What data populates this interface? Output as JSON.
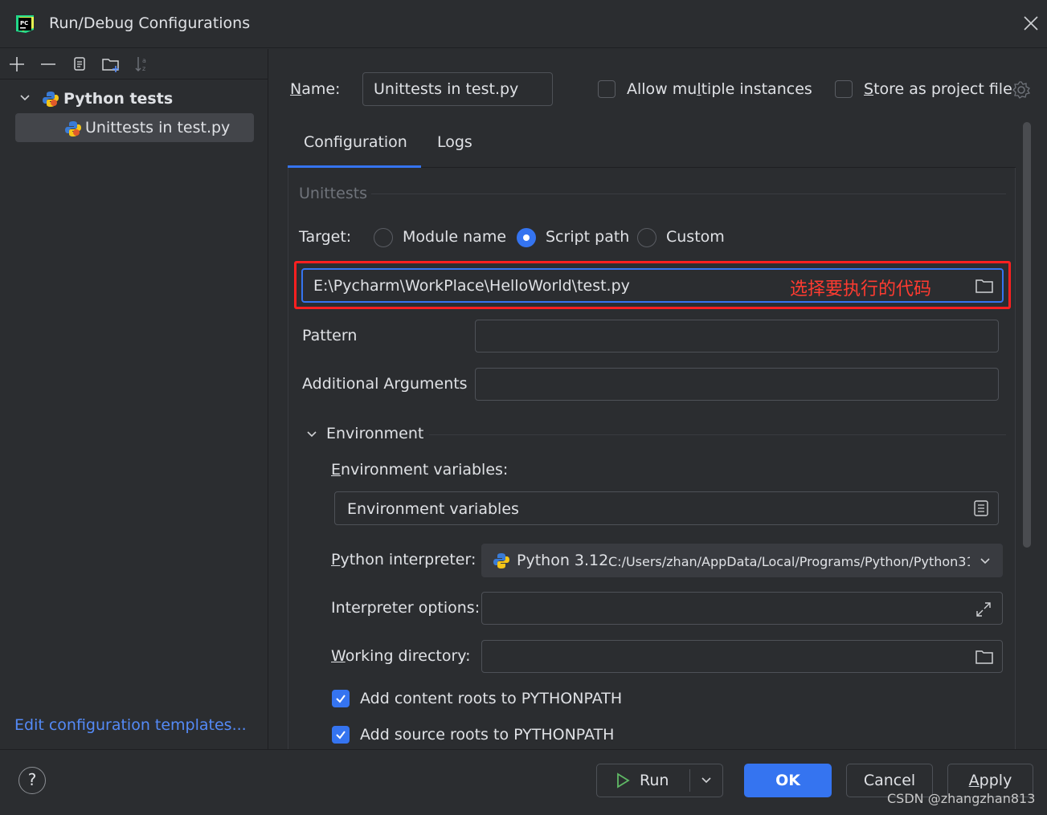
{
  "window": {
    "title": "Run/Debug Configurations"
  },
  "tree": {
    "parent_label": "Python tests",
    "child_label": "Unittests in test.py"
  },
  "left": {
    "edit_templates": "Edit configuration templates..."
  },
  "name_row": {
    "label_u": "N",
    "label_rest": "ame:",
    "value": "Unittests in test.py",
    "allow_multiple_pre": "Allow mu",
    "allow_multiple_u": "l",
    "allow_multiple_post": "tiple instances",
    "store_u": "S",
    "store_rest": "tore as project file"
  },
  "tabs": {
    "configuration": "Configuration",
    "logs": "Logs"
  },
  "section": {
    "title": "Unittests"
  },
  "target": {
    "label": "Target:",
    "options": [
      "Module name",
      "Script path",
      "Custom"
    ],
    "selected": "Script path",
    "path_value": "E:\\Pycharm\\WorkPlace\\HelloWorld\\test.py",
    "annotation": "选择要执行的代码"
  },
  "pattern": {
    "label": "Pattern"
  },
  "additional_args": {
    "label": "Additional Arguments"
  },
  "environment": {
    "title": "Environment",
    "env_vars_label_u": "E",
    "env_vars_label_rest": "nvironment variables:",
    "env_vars_placeholder": "Environment variables",
    "interpreter_label_u": "P",
    "interpreter_label_rest": "ython interpreter:",
    "interpreter_name": "Python 3.12",
    "interpreter_path": "C:/Users/zhan/AppData/Local/Programs/Python/Python31.",
    "interp_options_label": "Interpreter options:",
    "working_dir_label_u": "W",
    "working_dir_label_rest": "orking directory:",
    "content_roots_label": "Add content roots to PYTHONPATH",
    "source_roots_label": "Add source roots to PYTHONPATH"
  },
  "buttons": {
    "help": "?",
    "run": "Run",
    "ok": "OK",
    "cancel": "Cancel",
    "apply_u": "A",
    "apply_rest": "pply"
  },
  "watermark": "CSDN @zhangzhan813",
  "colors": {
    "accent": "#3574f0",
    "link": "#548af7",
    "highlight": "#ff2020",
    "background": "#2b2d30"
  },
  "icons": [
    "pycharm-logo-icon",
    "close-icon",
    "add-icon",
    "remove-icon",
    "copy-icon",
    "new-folder-icon",
    "sort-icon",
    "chevron-down-icon",
    "python-icon",
    "folder-icon",
    "list-icon",
    "expand-icon",
    "gear-icon",
    "play-icon",
    "check-icon"
  ]
}
